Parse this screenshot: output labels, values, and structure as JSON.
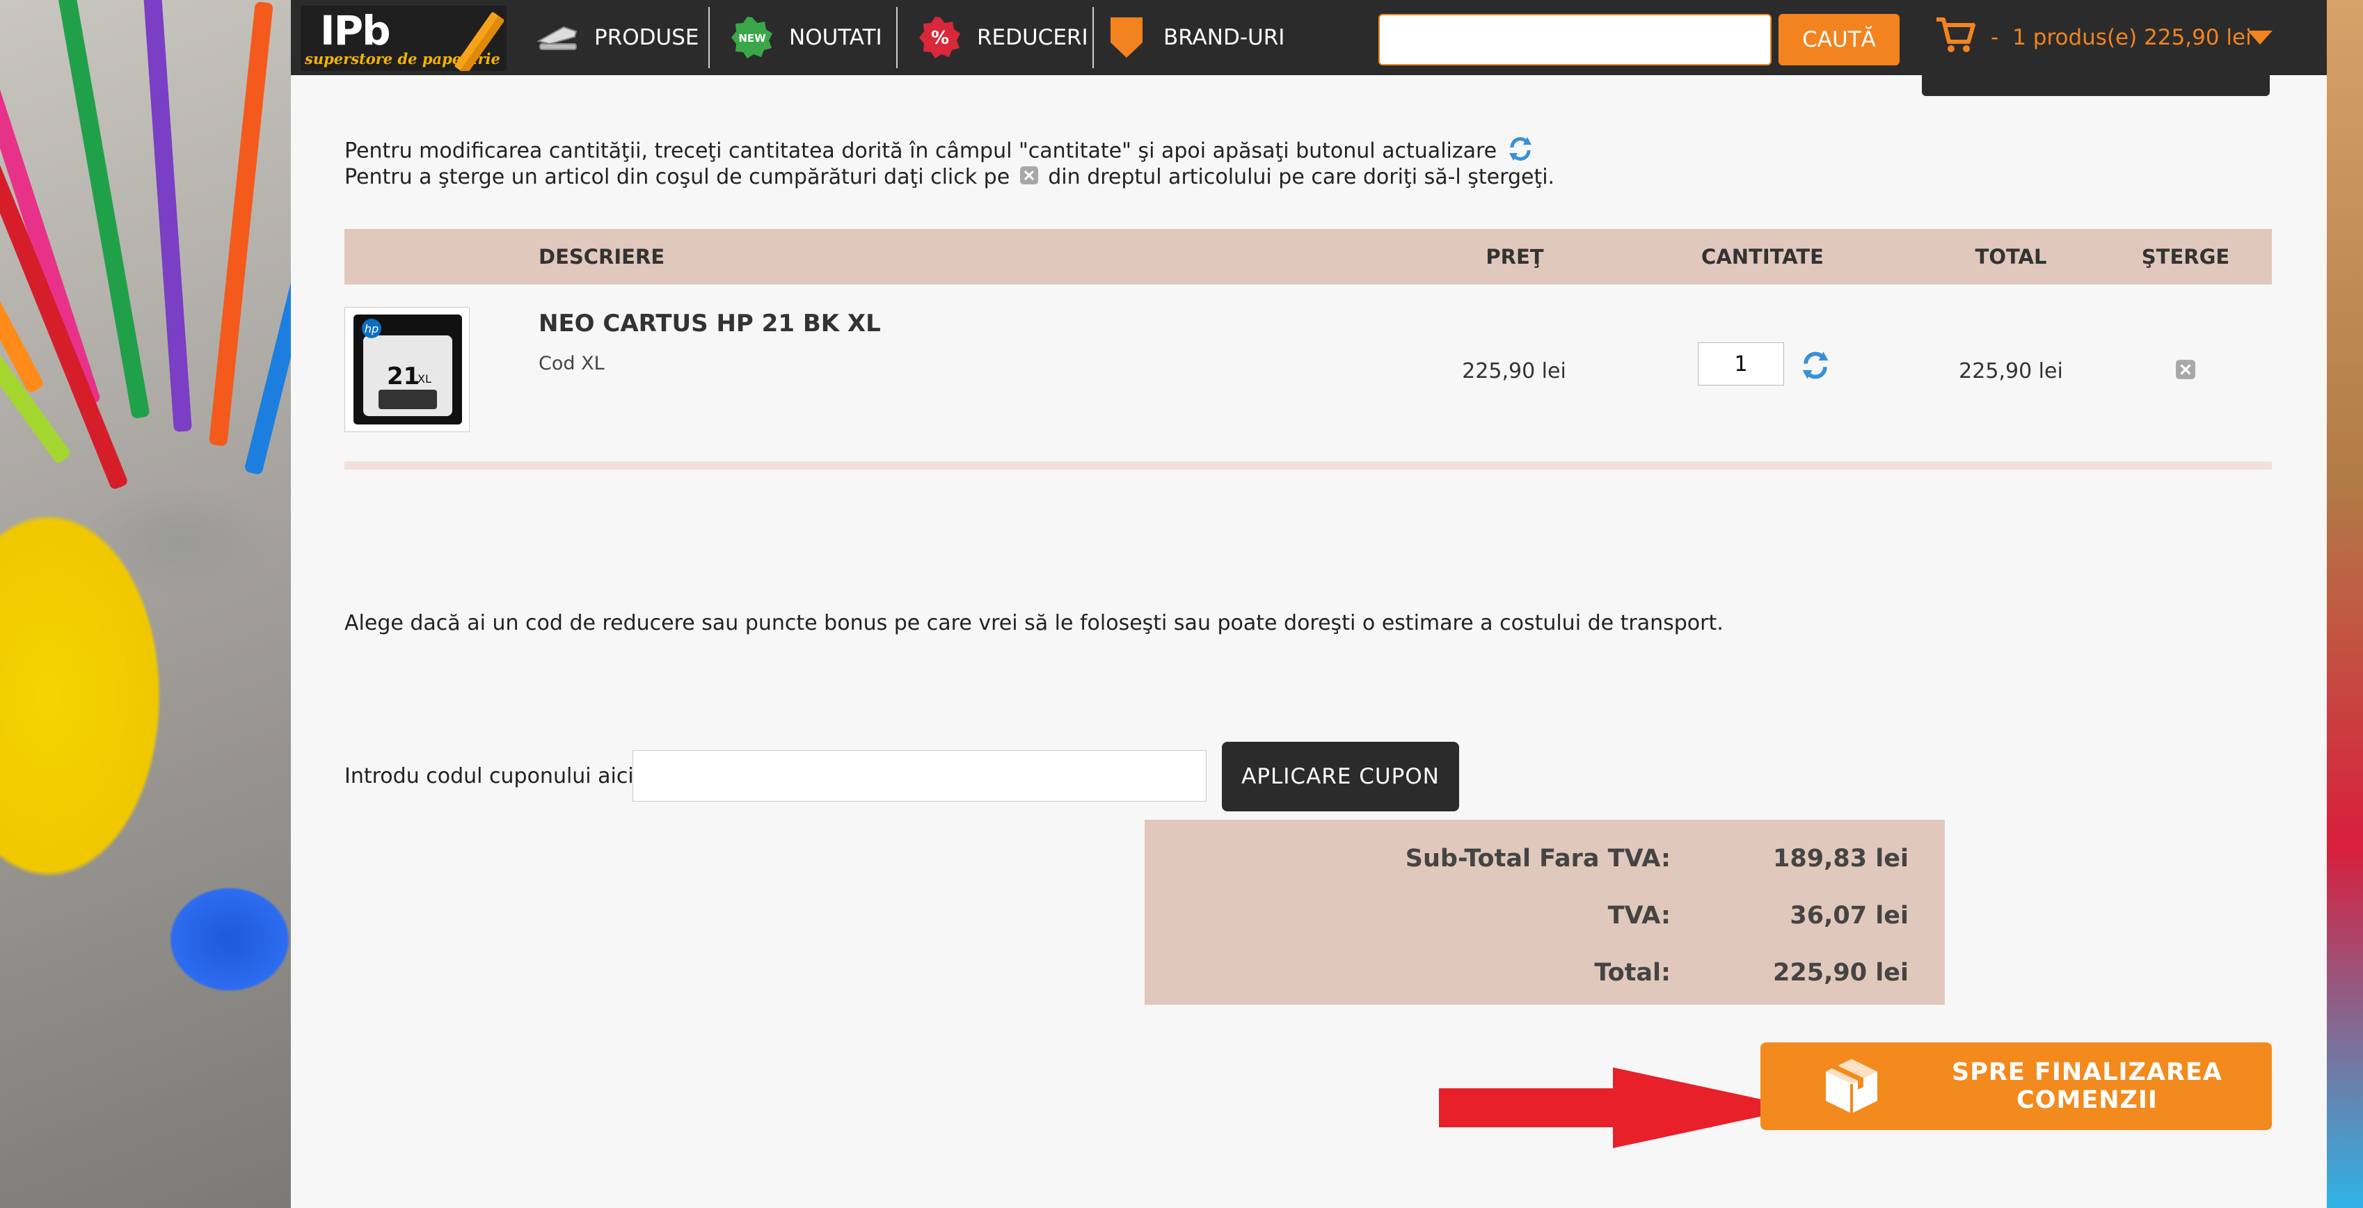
{
  "header": {
    "logo": {
      "text": "IPb",
      "subtitle": "superstore de papetarie"
    },
    "nav": [
      {
        "label": "PRODUSE",
        "icon": "stapler-icon"
      },
      {
        "label": "NOUTATI",
        "icon": "new-badge-icon"
      },
      {
        "label": "REDUCERI",
        "icon": "percent-badge-icon"
      },
      {
        "label": "BRAND-URI",
        "icon": "shield-icon"
      }
    ],
    "search": {
      "placeholder": "",
      "button_label": "CAUTĂ"
    },
    "cart": {
      "separator": "-",
      "summary": "1 produs(e) 225,90 lei",
      "icon": "cart-icon"
    }
  },
  "instructions": {
    "line1": "Pentru modificarea cantităţii, treceţi cantitatea dorită în câmpul \"cantitate\" şi apoi apăsaţi butonul actualizare",
    "line2_before": "Pentru a şterge un articol din coşul de cumpărături daţi click pe",
    "line2_after": "din dreptul articolului pe care doriţi să-l ştergeţi."
  },
  "table": {
    "headers": {
      "description": "DESCRIERE",
      "price": "PREŢ",
      "quantity": "CANTITATE",
      "total": "TOTAL",
      "delete": "ŞTERGE"
    },
    "rows": [
      {
        "name": "NEO CARTUS HP 21 BK XL",
        "code": "Cod XL",
        "price": "225,90 lei",
        "quantity": "1",
        "total": "225,90 lei",
        "thumb": {
          "brand": "hp",
          "model": "21",
          "suffix": "XL"
        }
      }
    ]
  },
  "discount_prompt": "Alege dacă ai un cod de reducere sau puncte bonus pe care vrei să le foloseşti sau poate doreşti o estimare a costului de transport.",
  "coupon": {
    "label": "Introdu codul cuponului aici:",
    "value": "",
    "button_label": "APLICARE CUPON"
  },
  "totals": [
    {
      "label": "Sub-Total Fara TVA:",
      "value": "189,83 lei"
    },
    {
      "label": "TVA:",
      "value": "36,07 lei"
    },
    {
      "label": "Total:",
      "value": "225,90 lei"
    }
  ],
  "checkout": {
    "label": "SPRE FINALIZAREA COMENZII",
    "icon": "package-box-icon"
  },
  "colors": {
    "accent": "#f2831f",
    "header_bg": "#2b2b2b",
    "table_head": "#e1c8bc",
    "refresh": "#3a8fd6",
    "arrow": "#e8202a"
  }
}
